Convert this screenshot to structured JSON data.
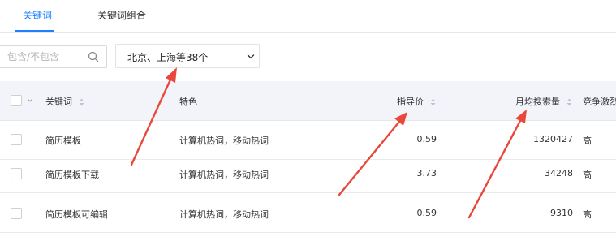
{
  "tabs": [
    {
      "label": "关键词",
      "active": true
    },
    {
      "label": "关键词组合",
      "active": false
    }
  ],
  "filters": {
    "search_placeholder": "包含/不包含",
    "region_value": "北京、上海等38个"
  },
  "table": {
    "columns": [
      "关键词",
      "特色",
      "指导价",
      "月均搜索量",
      "竞争激烈"
    ],
    "rows": [
      {
        "keyword": "简历模板",
        "feature": "计算机热词，移动热词",
        "price": "0.59",
        "monthly_search": "1320427",
        "competition": "高"
      },
      {
        "keyword": "简历模板下载",
        "feature": "计算机热词，移动热词",
        "price": "3.73",
        "monthly_search": "34248",
        "competition": "高"
      },
      {
        "keyword": "简历模板可编辑",
        "feature": "计算机热词，移动热词",
        "price": "0.59",
        "monthly_search": "9310",
        "competition": "高"
      }
    ]
  },
  "colors": {
    "accent": "#1e80ff",
    "header_bg": "#f3f4fa",
    "annotation_arrow": "#e8473a"
  },
  "icons": [
    "search-icon",
    "chevron-down-icon",
    "sort-icon",
    "annotation-arrow"
  ]
}
